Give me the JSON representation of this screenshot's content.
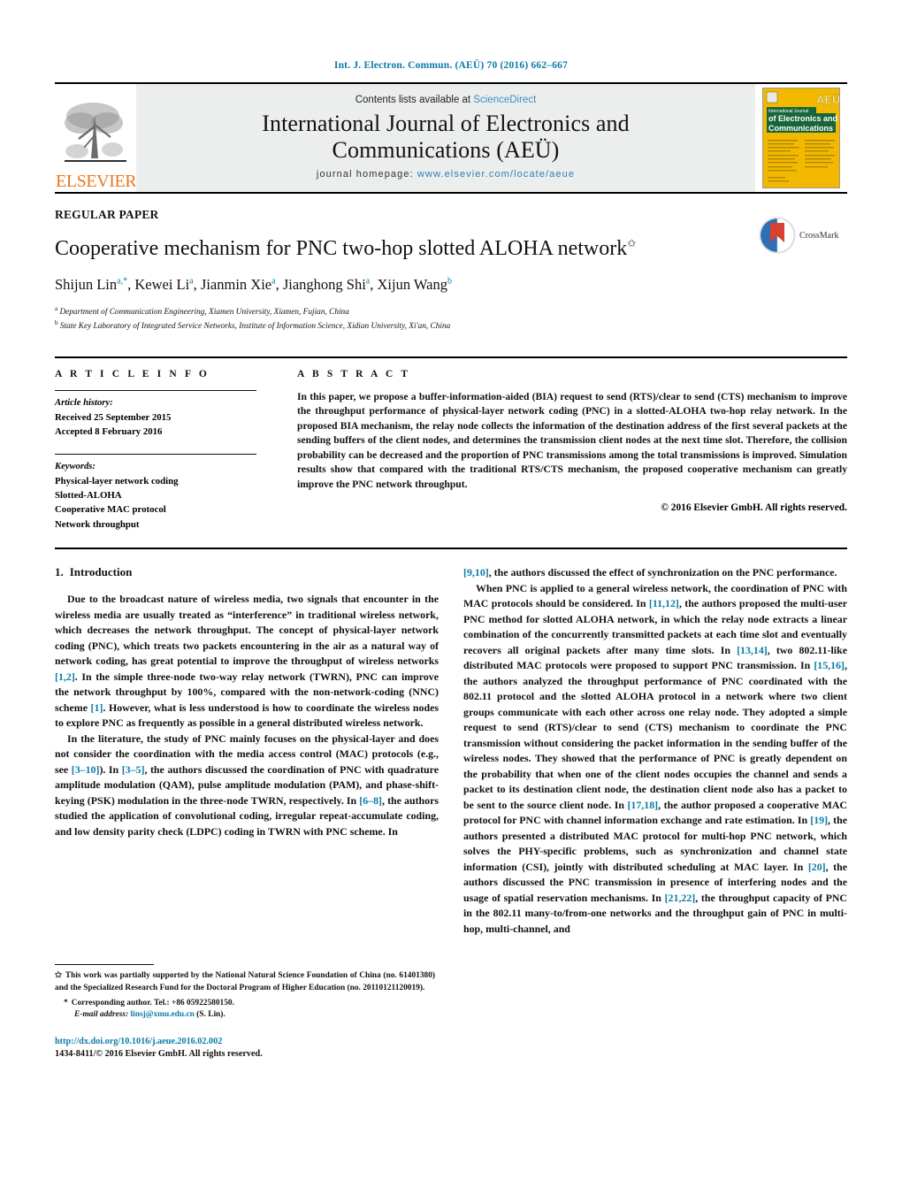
{
  "running_head": "Int. J. Electron. Commun. (AEÜ) 70 (2016) 662–667",
  "masthead": {
    "contents_prefix": "Contents lists available at ",
    "contents_link": "ScienceDirect",
    "journal_title_line1": "International Journal of Electronics and",
    "journal_title_line2": "Communications (AEÜ)",
    "homepage_label": "journal homepage: ",
    "homepage_url": "www.elsevier.com/locate/aeue",
    "publisher_wordmark": "ELSEVIER",
    "cover_line1": "International Journal",
    "cover_line2": "of Electronics and",
    "cover_line3": "Communications",
    "cover_badge": "AEÜ"
  },
  "article": {
    "type_label": "REGULAR PAPER",
    "title": "Cooperative mechanism for PNC two-hop slotted ALOHA network",
    "title_footnote_mark": "✩",
    "authors": [
      {
        "name": "Shijun Lin",
        "marks": "a,*"
      },
      {
        "name": "Kewei Li",
        "marks": "a"
      },
      {
        "name": "Jianmin Xie",
        "marks": "a"
      },
      {
        "name": "Jianghong Shi",
        "marks": "a"
      },
      {
        "name": "Xijun Wang",
        "marks": "b"
      }
    ],
    "affiliations": [
      {
        "mark": "a",
        "text": "Department of Communication Engineering, Xiamen University, Xiamen, Fujian, China"
      },
      {
        "mark": "b",
        "text": "State Key Laboratory of Integrated Service Networks, Institute of Information Science, Xidian University, Xi'an, China"
      }
    ],
    "crossmark_label": "CrossMark"
  },
  "info": {
    "heading": "A R T I C L E   I N F O",
    "history_label": "Article history:",
    "received": "Received 25 September 2015",
    "accepted": "Accepted 8 February 2016",
    "keywords_label": "Keywords:",
    "keywords": [
      "Physical-layer network coding",
      "Slotted-ALOHA",
      "Cooperative MAC protocol",
      "Network throughput"
    ]
  },
  "abstract": {
    "heading": "A B S T R A C T",
    "text": "In this paper, we propose a buffer-information-aided (BIA) request to send (RTS)/clear to send (CTS) mechanism to improve the throughput performance of physical-layer network coding (PNC) in a slotted-ALOHA two-hop relay network. In the proposed BIA mechanism, the relay node collects the information of the destination address of the first several packets at the sending buffers of the client nodes, and determines the transmission client nodes at the next time slot. Therefore, the collision probability can be decreased and the proportion of PNC transmissions among the total transmissions is improved. Simulation results show that compared with the traditional RTS/CTS mechanism, the proposed cooperative mechanism can greatly improve the PNC network throughput.",
    "copyright": "© 2016 Elsevier GmbH. All rights reserved."
  },
  "body": {
    "section_number": "1.",
    "section_title": "Introduction",
    "left_paragraphs": [
      "Due to the broadcast nature of wireless media, two signals that encounter in the wireless media are usually treated as “interference” in traditional wireless network, which decreases the network throughput. The concept of physical-layer network coding (PNC), which treats two packets encountering in the air as a natural way of network coding, has great potential to improve the throughput of wireless networks [1,2]. In the simple three-node two-way relay network (TWRN), PNC can improve the network throughput by 100%, compared with the non-network-coding (NNC) scheme [1]. However, what is less understood is how to coordinate the wireless nodes to explore PNC as frequently as possible in a general distributed wireless network.",
      "In the literature, the study of PNC mainly focuses on the physical-layer and does not consider the coordination with the media access control (MAC) protocols (e.g., see [3–10]). In [3–5], the authors discussed the coordination of PNC with quadrature amplitude modulation (QAM), pulse amplitude modulation (PAM), and phase-shift-keying (PSK) modulation in the three-node TWRN, respectively. In [6–8], the authors studied the application of convolutional coding, irregular repeat-accumulate coding, and low density parity check (LDPC) coding in TWRN with PNC scheme. In"
    ],
    "right_paragraphs": [
      "[9,10], the authors discussed the effect of synchronization on the PNC performance.",
      "When PNC is applied to a general wireless network, the coordination of PNC with MAC protocols should be considered. In [11,12], the authors proposed the multi-user PNC method for slotted ALOHA network, in which the relay node extracts a linear combination of the concurrently transmitted packets at each time slot and eventually recovers all original packets after many time slots. In [13,14], two 802.11-like distributed MAC protocols were proposed to support PNC transmission. In [15,16], the authors analyzed the throughput performance of PNC coordinated with the 802.11 protocol and the slotted ALOHA protocol in a network where two client groups communicate with each other across one relay node. They adopted a simple request to send (RTS)/clear to send (CTS) mechanism to coordinate the PNC transmission without considering the packet information in the sending buffer of the wireless nodes. They showed that the performance of PNC is greatly dependent on the probability that when one of the client nodes occupies the channel and sends a packet to its destination client node, the destination client node also has a packet to be sent to the source client node. In [17,18], the author proposed a cooperative MAC protocol for PNC with channel information exchange and rate estimation. In [19], the authors presented a distributed MAC protocol for multi-hop PNC network, which solves the PHY-specific problems, such as synchronization and channel state information (CSI), jointly with distributed scheduling at MAC layer. In [20], the authors discussed the PNC transmission in presence of interfering nodes and the usage of spatial reservation mechanisms. In [21,22], the throughput capacity of PNC in the 802.11 many-to/from-one networks and the throughput gain of PNC in multi-hop, multi-channel, and"
    ]
  },
  "footnotes": {
    "funding_mark": "✩",
    "funding_text": "This work was partially supported by the National Natural Science Foundation of China (no. 61401380) and the Specialized Research Fund for the Doctoral Program of Higher Education (no. 20110121120019).",
    "corresponding_mark": "*",
    "corresponding_text": "Corresponding author. Tel.: +86 05922580150.",
    "email_label": "E-mail address:",
    "email": "linsj@xmu.edu.cn",
    "email_suffix": "(S. Lin).",
    "doi": "http://dx.doi.org/10.1016/j.aeue.2016.02.002",
    "issn_line": "1434-8411/© 2016 Elsevier GmbH. All rights reserved."
  },
  "colors": {
    "link_blue": "#0b7ba8",
    "elsevier_orange": "#E87722",
    "cover_yellow": "#f2b705",
    "masthead_grey": "#eceded"
  }
}
